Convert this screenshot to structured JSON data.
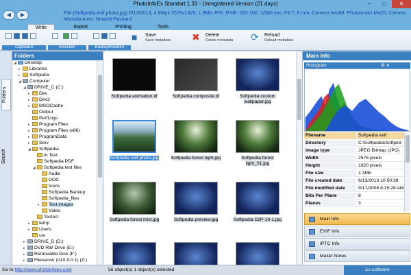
{
  "window": {
    "title": "PhotoInfoEx Standart 1.33 - Unregistered Version (21 days)",
    "min": "–",
    "max": "□",
    "close": "✕"
  },
  "infobar": {
    "line1": "File:(Softpedia exif photo.jpg) 6/13/2013; 4.9Mpx 2576x1920; 1.3Mb JPG. EXIF: ISO 100; 1/500 sec; F4.7; 6 mm; Camera Model: Photosmart M425; Camera",
    "line2": "Manufacturer: Hewlett-Packard",
    "back": "◀",
    "forward": "▶"
  },
  "tabs": [
    "Write",
    "Export",
    "Printing",
    "Tools"
  ],
  "ribbon": {
    "groups": [
      "Clipboard",
      "Selection",
      "Backup/Restore"
    ],
    "save": {
      "label": "Save",
      "sub": "Save metadata"
    },
    "delete": {
      "label": "Delete",
      "sub": "Delete metadata"
    },
    "reload": {
      "label": "Reload",
      "sub": "Reload metadata"
    }
  },
  "sidetabs": [
    "Folders",
    "Search"
  ],
  "folders": {
    "title": "Folders",
    "tree": [
      {
        "label": "Desktop",
        "exp": "◢",
        "icon": "blue"
      },
      {
        "label": "Libraries",
        "exp": "▸",
        "icon": "folder"
      },
      {
        "label": "Softpedia",
        "exp": "▸",
        "icon": "folder"
      },
      {
        "label": "Computer",
        "exp": "◢",
        "icon": "drive"
      },
      {
        "label": "DRIVE_C (C:)",
        "exp": "◢",
        "icon": "drive"
      },
      {
        "label": "Dev",
        "exp": "▸",
        "icon": "folder"
      },
      {
        "label": "Dev2",
        "exp": "▸",
        "icon": "folder"
      },
      {
        "label": "MSOCache",
        "exp": "▸",
        "icon": "folder"
      },
      {
        "label": "Output",
        "exp": "",
        "icon": "folder"
      },
      {
        "label": "PerfLogs",
        "exp": "",
        "icon": "folder"
      },
      {
        "label": "Program Files",
        "exp": "▸",
        "icon": "folder"
      },
      {
        "label": "Program Files (x86)",
        "exp": "▸",
        "icon": "folder"
      },
      {
        "label": "ProgramData",
        "exp": "▸",
        "icon": "folder"
      },
      {
        "label": "Serv",
        "exp": "▸",
        "icon": "folder"
      },
      {
        "label": "Softpedia",
        "exp": "◢",
        "icon": "folder"
      },
      {
        "label": "In Test",
        "exp": "",
        "icon": "folder"
      },
      {
        "label": "Softpedia PDF",
        "exp": "",
        "icon": "folder"
      },
      {
        "label": "Softpedia test files",
        "exp": "◢",
        "icon": "folder"
      },
      {
        "label": "Audio",
        "exp": "",
        "icon": "folder"
      },
      {
        "label": "DOC",
        "exp": "",
        "icon": "folder"
      },
      {
        "label": "Icons",
        "exp": "",
        "icon": "folder"
      },
      {
        "label": "Softpedia Backup",
        "exp": "",
        "icon": "folder"
      },
      {
        "label": "Softpedia_files",
        "exp": "",
        "icon": "folder"
      },
      {
        "label": "Test images",
        "exp": "▸",
        "icon": "folder"
      },
      {
        "label": "Video",
        "exp": "",
        "icon": "folder"
      },
      {
        "label": "Tested",
        "exp": "",
        "icon": "folder"
      },
      {
        "label": "temp",
        "exp": "▸",
        "icon": "folder"
      },
      {
        "label": "Users",
        "exp": "▸",
        "icon": "folder"
      },
      {
        "label": "usr",
        "exp": "",
        "icon": "folder"
      },
      {
        "label": "DRIVE_D (D:)",
        "exp": "▸",
        "icon": "drive"
      },
      {
        "label": "DVD RW Drive (E:)",
        "exp": "▸",
        "icon": "drive"
      },
      {
        "label": "Removable Disk (F:)",
        "exp": "▸",
        "icon": "drive"
      },
      {
        "label": "Fileserver (\\\\10.9.0.1) (Z:)",
        "exp": "▸",
        "icon": "drive"
      }
    ]
  },
  "thumbs": [
    {
      "name": "Softpedia animation.tif",
      "img": "black"
    },
    {
      "name": "Softpedia composite.tif",
      "img": "dark"
    },
    {
      "name": "Softpedia custom wallpaper.jpg",
      "img": "blue"
    },
    {
      "name": "Softpedia exif photo.jpg",
      "img": "forest",
      "selected": true
    },
    {
      "name": "Softpedia forest light.jpg",
      "img": "forest2"
    },
    {
      "name": "Softpedia forest light_01.jpg",
      "img": "forest2"
    },
    {
      "name": "Softpedia forest mist.jpg",
      "img": "forest3"
    },
    {
      "name": "Softpedia preview.jpg",
      "img": "blue"
    },
    {
      "name": "Softpedia S2P-19-1.jpg",
      "img": "blue"
    },
    {
      "name": "",
      "img": "blue"
    },
    {
      "name": "",
      "img": "blue"
    },
    {
      "name": "",
      "img": "blue"
    }
  ],
  "info": {
    "title": "Main Info",
    "histogram_label": "Histogram",
    "histogram_icons": "⚙ ✕",
    "props": [
      {
        "k": "Filename",
        "v": "Softpedia exif"
      },
      {
        "k": "Directory",
        "v": "C:\\Softpedia\\Softped"
      },
      {
        "k": "Image type",
        "v": "JPEG Bitmap (JPG)"
      },
      {
        "k": "Width",
        "v": "2576 pixels"
      },
      {
        "k": "Height",
        "v": "1920 pixels"
      },
      {
        "k": "File size",
        "v": "1.3Mb"
      },
      {
        "k": "File created date",
        "v": "6/13/2013 10:50:38"
      },
      {
        "k": "File modified date",
        "v": "9/17/2008 8:15:28 AM"
      },
      {
        "k": "Bits Per Plane",
        "v": "8"
      },
      {
        "k": "Planes",
        "v": "3"
      }
    ],
    "panels": [
      "Main Info",
      "EXIF Info",
      "IPTC Info",
      "Maker Notes"
    ]
  },
  "status": {
    "goto": "Go to",
    "link": "http://www.photoinfoex.com",
    "count": "56 object(s) 1 object(s) selected",
    "brand": "Ex software"
  },
  "colors": {
    "accent": "#3a7fc0",
    "title": "#6fb2df",
    "selection": "#3a86d8",
    "highlight": "#f3d9a0"
  }
}
